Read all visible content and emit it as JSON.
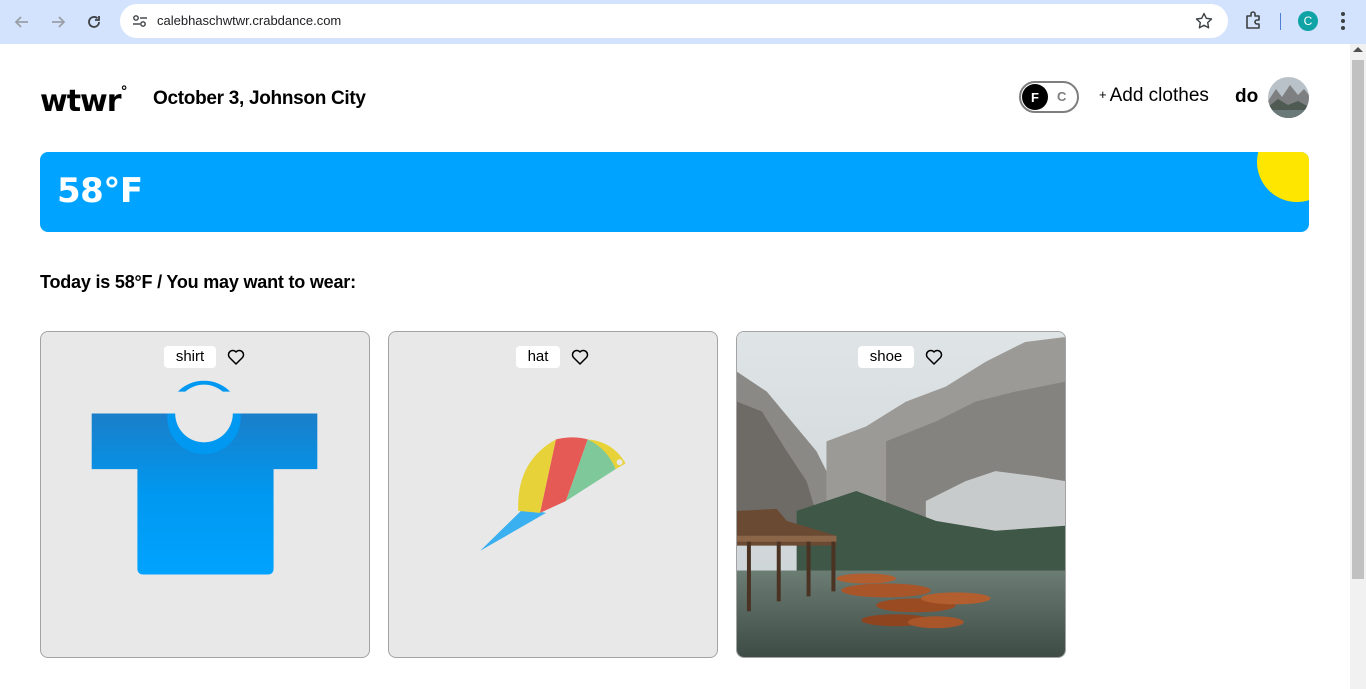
{
  "browser": {
    "url": "calebhaschwtwr.crabdance.com",
    "profile_initial": "C"
  },
  "header": {
    "logo": "wtwr",
    "logo_mark": "°",
    "date_location": "October 3, Johnson City",
    "unit_toggle": {
      "active": "F",
      "inactive": "C"
    },
    "add_clothes_plus": "+",
    "add_clothes": "Add clothes",
    "user_name": "do"
  },
  "weather": {
    "temperature": "58°F",
    "condition_icon": "sun-icon"
  },
  "recommendation": "Today is 58°F / You may want to wear:",
  "items": [
    {
      "name": "shirt",
      "image": "shirt-illustration",
      "liked": false
    },
    {
      "name": "hat",
      "image": "cap-illustration",
      "liked": false
    },
    {
      "name": "shoe",
      "image": "mountain-lake-photo",
      "liked": false
    }
  ],
  "colors": {
    "accent_blue": "#00A3FF",
    "sun_yellow": "#FEE600",
    "card_bg": "#E8E8E8"
  }
}
